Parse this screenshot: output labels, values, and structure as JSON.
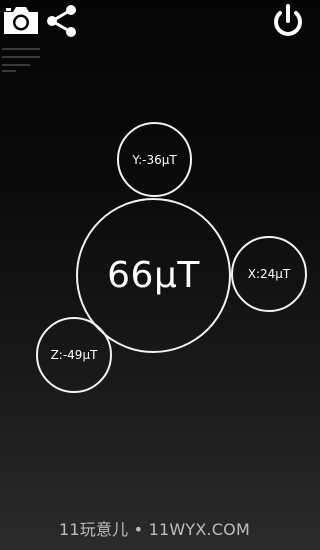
{
  "toolbar": {
    "icons": [
      "camera-icon",
      "share-icon",
      "power-icon"
    ]
  },
  "readings": {
    "total": "66µT",
    "y": "Y:-36µT",
    "x": "X:24µT",
    "z": "Z:-49µT"
  },
  "watermark": "11玩意儿 • 11WYX.COM",
  "colors": {
    "background": "#000000",
    "circle_stroke": "#f2f2f2",
    "text": "#ffffff"
  }
}
